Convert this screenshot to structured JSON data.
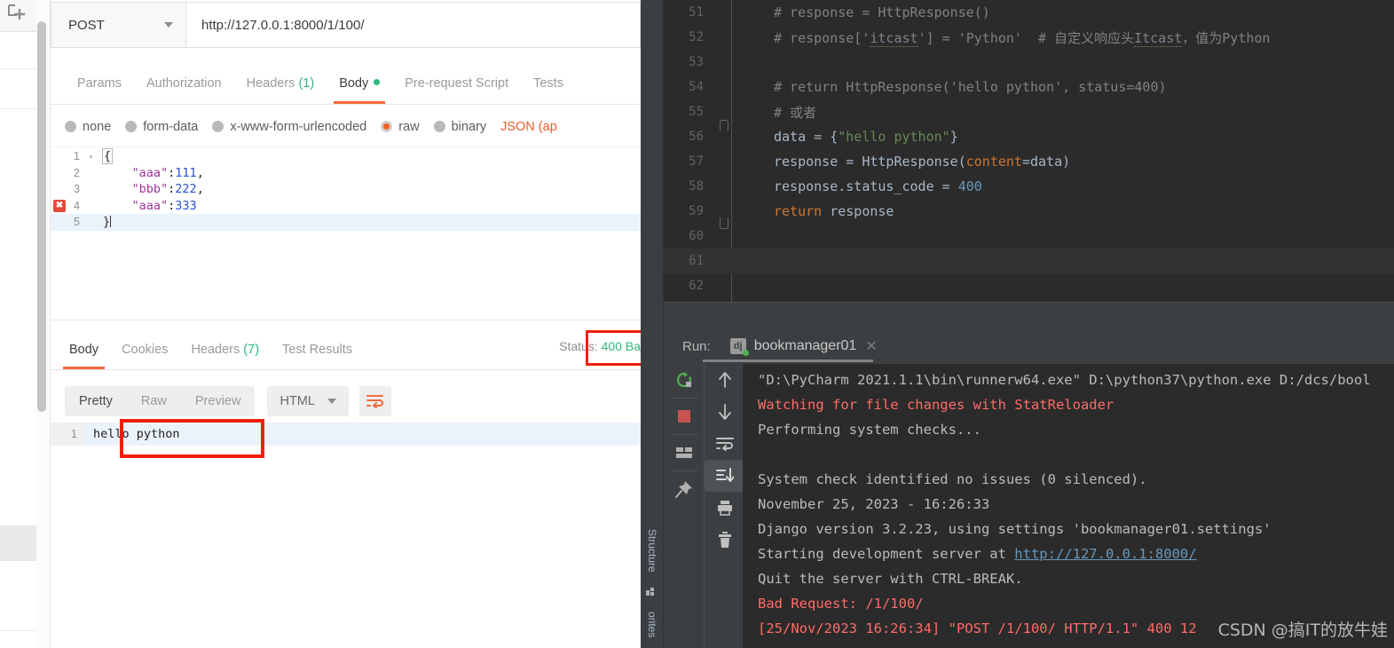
{
  "far_left": {
    "new_tab_icon": "new-tab-icon"
  },
  "postman": {
    "request": {
      "method": "POST",
      "url": "http://127.0.0.1:8000/1/100/",
      "tabs": [
        {
          "label": "Params",
          "active": false
        },
        {
          "label": "Authorization",
          "active": false
        },
        {
          "label": "Headers",
          "count": "(1)",
          "active": false
        },
        {
          "label": "Body",
          "dot": true,
          "active": true
        },
        {
          "label": "Pre-request Script",
          "active": false
        },
        {
          "label": "Tests",
          "active": false
        }
      ],
      "body_types": [
        {
          "label": "none",
          "selected": false
        },
        {
          "label": "form-data",
          "selected": false
        },
        {
          "label": "x-www-form-urlencoded",
          "selected": false
        },
        {
          "label": "raw",
          "selected": true
        },
        {
          "label": "binary",
          "selected": false
        }
      ],
      "content_type": "JSON (ap",
      "body_lines": [
        {
          "num": "1",
          "fold": "▾",
          "text": "{",
          "error": false,
          "current": false
        },
        {
          "num": "2",
          "fold": "",
          "text": "    \"aaa\":111,",
          "error": false,
          "current": false
        },
        {
          "num": "3",
          "fold": "",
          "text": "    \"bbb\":222,",
          "error": false,
          "current": false
        },
        {
          "num": "4",
          "fold": "",
          "text": "    \"aaa\":333",
          "error": true,
          "current": false
        },
        {
          "num": "5",
          "fold": "",
          "text": "}",
          "error": false,
          "current": true
        }
      ]
    },
    "response": {
      "tabs": [
        {
          "label": "Body",
          "active": true
        },
        {
          "label": "Cookies",
          "active": false
        },
        {
          "label": "Headers",
          "count": "(7)",
          "active": false
        },
        {
          "label": "Test Results",
          "active": false
        }
      ],
      "status_label": "Status:",
      "status_value": "400 Ba",
      "view_modes": [
        {
          "label": "Pretty",
          "active": true
        },
        {
          "label": "Raw",
          "active": false
        },
        {
          "label": "Preview",
          "active": false
        }
      ],
      "format": "HTML",
      "wrap_icon": "word-wrap-icon",
      "body_line_number": "1",
      "body_text": "hello python"
    }
  },
  "pycharm": {
    "tool_tabs": {
      "structure": "Structure",
      "favorites": "orites"
    },
    "editor_lines": [
      {
        "num": "51",
        "fold": "",
        "current": false,
        "tokens": [
          {
            "t": "# response = HttpResponse()",
            "c": "cmt"
          }
        ]
      },
      {
        "num": "52",
        "fold": "",
        "current": false,
        "tokens": [
          {
            "t": "# response['itcast'] = 'Python'  # 自定义响应头Itcast，值为Python",
            "c": "cmt"
          }
        ]
      },
      {
        "num": "53",
        "fold": "",
        "current": false,
        "tokens": []
      },
      {
        "num": "54",
        "fold": "",
        "current": false,
        "tokens": [
          {
            "t": "# return HttpResponse('hello python', status=400)",
            "c": "cmt"
          }
        ]
      },
      {
        "num": "55",
        "fold": "top",
        "current": false,
        "tokens": [
          {
            "t": "# 或者",
            "c": "cmt"
          }
        ]
      },
      {
        "num": "56",
        "fold": "",
        "current": false,
        "tokens": [
          {
            "t": "data = {",
            "c": "fn"
          },
          {
            "t": "\"hello python\"",
            "c": "str"
          },
          {
            "t": "}",
            "c": "fn"
          }
        ]
      },
      {
        "num": "57",
        "fold": "",
        "current": false,
        "tokens": [
          {
            "t": "response = HttpResponse(",
            "c": "fn"
          },
          {
            "t": "content",
            "c": "param"
          },
          {
            "t": "=data)",
            "c": "fn"
          }
        ]
      },
      {
        "num": "58",
        "fold": "",
        "current": false,
        "tokens": [
          {
            "t": "response.status_code = ",
            "c": "fn"
          },
          {
            "t": "400",
            "c": "num"
          }
        ]
      },
      {
        "num": "59",
        "fold": "bottom",
        "current": false,
        "tokens": [
          {
            "t": "return",
            "c": "kw"
          },
          {
            "t": " response",
            "c": "fn"
          }
        ]
      },
      {
        "num": "60",
        "fold": "",
        "current": false,
        "tokens": []
      },
      {
        "num": "61",
        "fold": "",
        "current": true,
        "tokens": []
      },
      {
        "num": "62",
        "fold": "",
        "current": false,
        "tokens": []
      }
    ],
    "run": {
      "label": "Run:",
      "config_icon": "django-icon",
      "config_name": "bookmanager01",
      "close_icon": "close-icon",
      "toolbar_left": [
        {
          "name": "rerun-icon"
        },
        {
          "name": "stop-icon"
        },
        {
          "name": "layout-icon"
        },
        {
          "name": "pin-icon"
        }
      ],
      "toolbar_right": [
        {
          "name": "up-arrow-icon"
        },
        {
          "name": "down-arrow-icon"
        },
        {
          "name": "soft-wrap-icon"
        },
        {
          "name": "scroll-to-end-icon",
          "selected": true
        },
        {
          "name": "print-icon"
        },
        {
          "name": "trash-icon"
        }
      ],
      "console_lines": [
        {
          "text": "\"D:\\PyCharm 2021.1.1\\bin\\runnerw64.exe\" D:\\python37\\python.exe D:/dcs/bool",
          "style": "normal"
        },
        {
          "text": "Watching for file changes with StatReloader",
          "style": "error"
        },
        {
          "text": "Performing system checks...",
          "style": "normal"
        },
        {
          "text": "",
          "style": "normal"
        },
        {
          "text": "System check identified no issues (0 silenced).",
          "style": "normal"
        },
        {
          "text": "November 25, 2023 - 16:26:33",
          "style": "normal"
        },
        {
          "text": "Django version 3.2.23, using settings 'bookmanager01.settings'",
          "style": "normal"
        },
        {
          "text": "Starting development server at ",
          "style": "link",
          "link": "http://127.0.0.1:8000/"
        },
        {
          "text": "Quit the server with CTRL-BREAK.",
          "style": "normal"
        },
        {
          "text": "Bad Request: /1/100/",
          "style": "error"
        },
        {
          "text": "[25/Nov/2023 16:26:34] \"POST /1/100/ HTTP/1.1\" 400 12",
          "style": "error"
        }
      ]
    },
    "watermark": "CSDN @搞IT的放牛娃"
  },
  "colors": {
    "accent_orange": "#f26b3a",
    "green": "#2eb67d",
    "highlight_red": "#f41e0a",
    "editor_bg": "#2b2b2b",
    "panel_bg": "#3c3f41"
  }
}
